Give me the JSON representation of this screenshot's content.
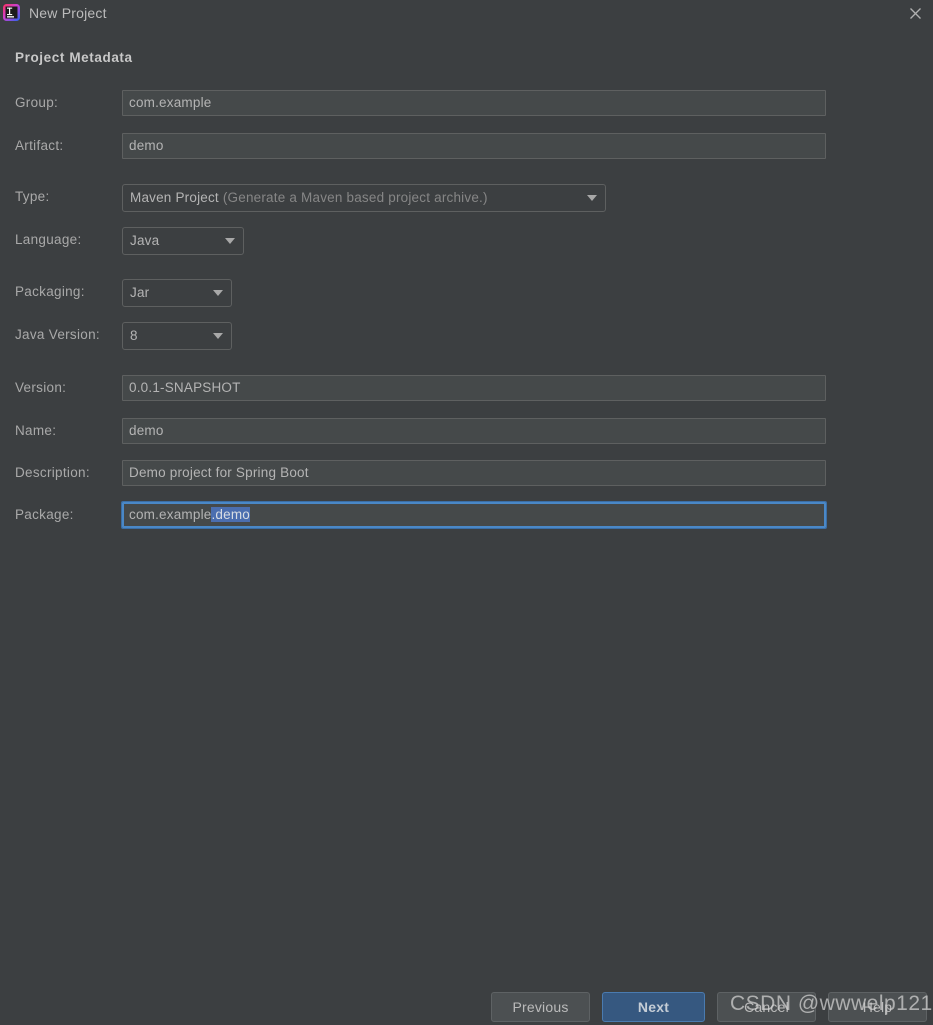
{
  "window": {
    "title": "New Project",
    "app_icon": "intellij-idea-icon",
    "close_icon": "close-icon"
  },
  "section": {
    "header": "Project Metadata"
  },
  "form": {
    "group": {
      "label": "Group:",
      "value": "com.example"
    },
    "artifact": {
      "label": "Artifact:",
      "value": "demo"
    },
    "type": {
      "label": "Type:",
      "value": "Maven Project",
      "hint": "(Generate a Maven based project archive.)",
      "icon": "chevron-down-icon"
    },
    "language": {
      "label": "Language:",
      "value": "Java",
      "icon": "chevron-down-icon"
    },
    "packaging": {
      "label": "Packaging:",
      "value": "Jar",
      "icon": "chevron-down-icon"
    },
    "java_version": {
      "label": "Java Version:",
      "value": "8",
      "icon": "chevron-down-icon"
    },
    "version": {
      "label": "Version:",
      "value": "0.0.1-SNAPSHOT"
    },
    "name": {
      "label": "Name:",
      "value": "demo"
    },
    "description": {
      "label": "Description:",
      "value": "Demo project for Spring Boot"
    },
    "package": {
      "label": "Package:",
      "value_prefix": "com.example",
      "value_selected": ".demo"
    }
  },
  "footer": {
    "previous": "Previous",
    "next": "Next",
    "cancel": "Cancel",
    "help": "Help"
  },
  "watermark": {
    "text": "CSDN @wwwelp121"
  },
  "colors": {
    "dialog_background": "#3c3f41",
    "field_background": "#45494a",
    "field_border": "#5e6060",
    "primary_button": "#365880",
    "focus_border": "#4a88c7",
    "selection": "#4b6eaf",
    "label_text": "#a9a9a9"
  }
}
